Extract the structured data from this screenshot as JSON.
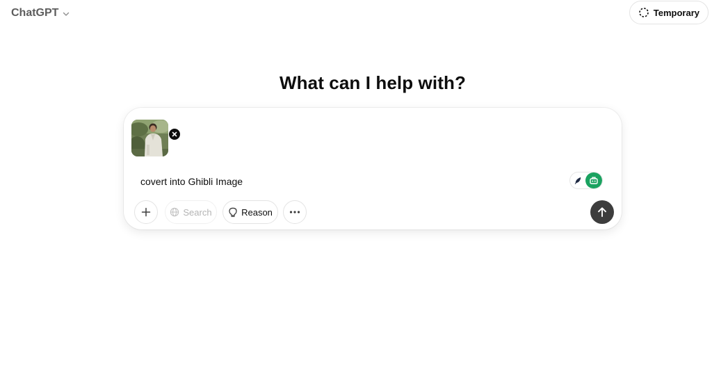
{
  "header": {
    "model_name": "ChatGPT",
    "temporary_label": "Temporary"
  },
  "main": {
    "title": "What can I help with?"
  },
  "composer": {
    "attachment": {
      "type": "image",
      "icon": "photo-thumbnail"
    },
    "prompt_text": "covert into Ghibli Image",
    "tools": {
      "add_icon": "plus-icon",
      "search_label": "Search",
      "reason_label": "Reason",
      "more_icon": "ellipsis-icon"
    },
    "send_icon": "arrow-up-icon"
  },
  "colors": {
    "send_button": "#3d3d3d",
    "extension_green": "#1aa260",
    "text_primary": "#0d0d0d",
    "text_muted": "#5d5d5d",
    "text_disabled": "#b4b4b4"
  }
}
